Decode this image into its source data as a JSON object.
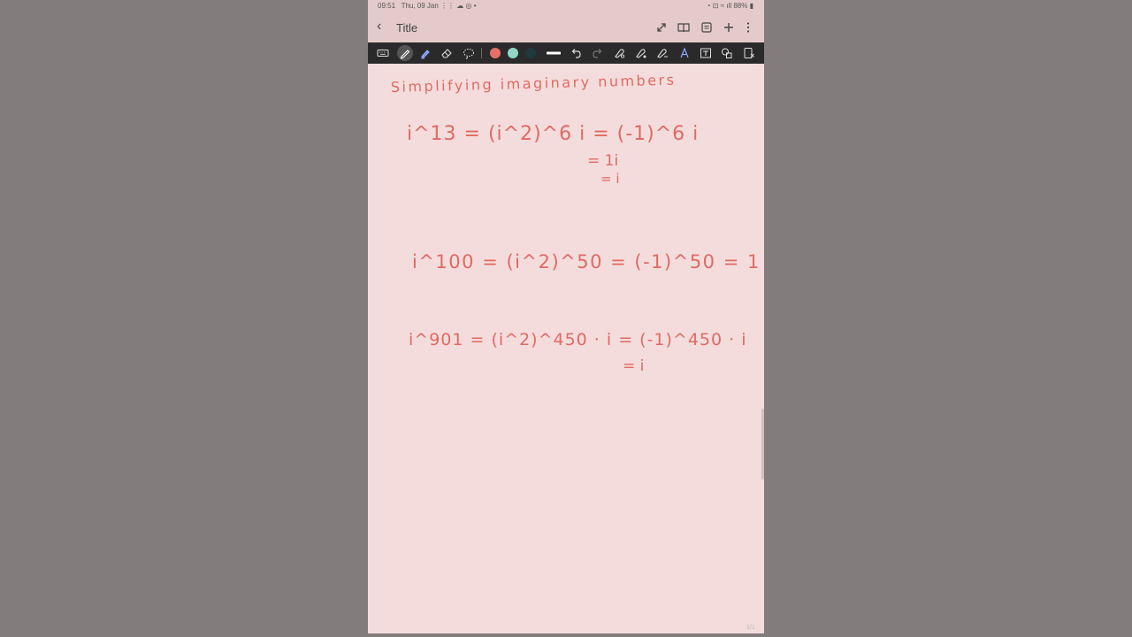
{
  "status_bar": {
    "time": "09:51",
    "date": "Thu, 09 Jan",
    "battery": "88%"
  },
  "header": {
    "title": "Title"
  },
  "toolbar": {
    "colors": {
      "red": "#e8706a",
      "teal": "#8fd6c6",
      "dark_teal": "#1e3a40"
    }
  },
  "note": {
    "heading": "Simplifying imaginary numbers",
    "line1": "i^13 = (i^2)^6 i = (-1)^6 i",
    "line1b": "= 1i",
    "line1c": "= i",
    "line2": "i^100 = (i^2)^50 = (-1)^50 = 1",
    "line3": "i^901 = (i^2)^450 · i = (-1)^450 · i",
    "line3b": "= i"
  },
  "page_indicator": "1/1"
}
